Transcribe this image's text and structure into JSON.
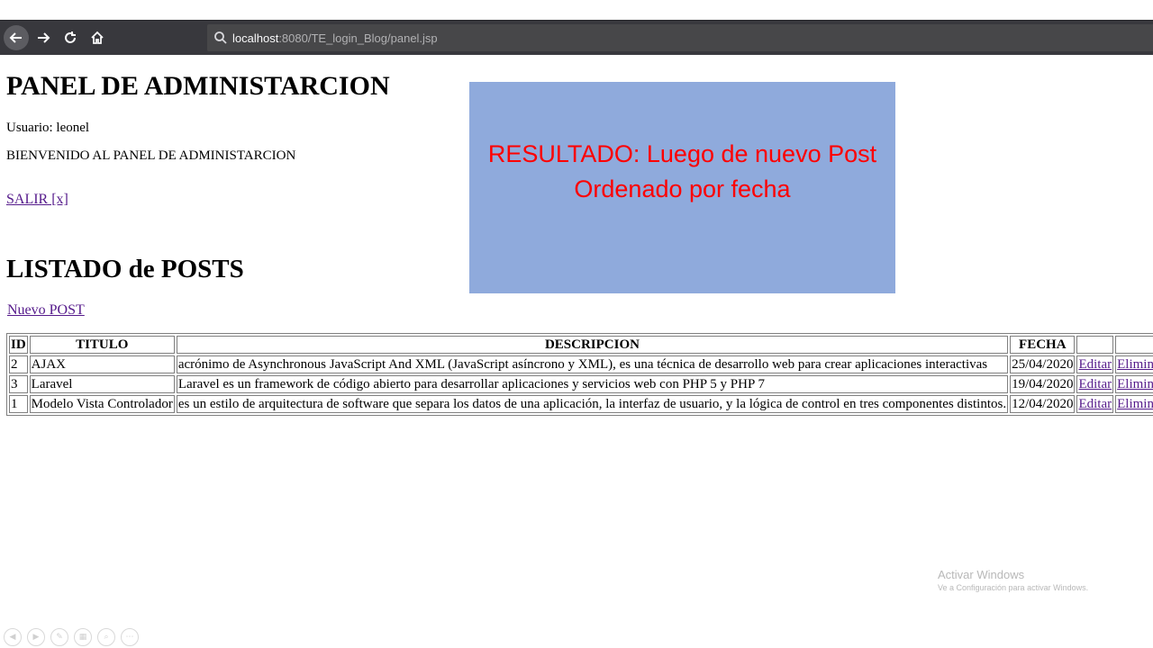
{
  "browser": {
    "url_host": "localhost",
    "url_path": ":8080/TE_login_Blog/panel.jsp"
  },
  "page": {
    "title": "PANEL DE ADMINISTARCION",
    "user_line": "Usuario: leonel",
    "welcome": "BIENVENIDO AL PANEL DE ADMINISTARCION",
    "logout_label": "SALIR [x]",
    "list_title": "LISTADO de POSTS",
    "new_post_label": "Nuevo POST"
  },
  "overlay": {
    "line1": "RESULTADO: Luego de nuevo Post",
    "line2": "Ordenado por fecha",
    "background": "#8faadc",
    "text_color": "#ff0000"
  },
  "table": {
    "headers": [
      "ID",
      "TITULO",
      "DESCRIPCION",
      "FECHA",
      "",
      ""
    ],
    "rows": [
      {
        "id": "2",
        "titulo": "AJAX",
        "descripcion": "acrónimo de Asynchronous JavaScript And XML (JavaScript asíncrono y XML), es una técnica de desarrollo web para crear aplicaciones interactivas",
        "fecha": "25/04/2020",
        "edit": "Editar",
        "delete": "Eliminar"
      },
      {
        "id": "3",
        "titulo": "Laravel",
        "descripcion": "Laravel es un framework de código abierto para desarrollar aplicaciones y servicios web con PHP 5 y PHP 7",
        "fecha": "19/04/2020",
        "edit": "Editar",
        "delete": "Eliminar"
      },
      {
        "id": "1",
        "titulo": "Modelo Vista Controlador",
        "descripcion": "es un estilo de arquitectura de software que separa los datos de una aplicación, la interfaz de usuario, y la lógica de control en tres componentes distintos.",
        "fecha": "12/04/2020",
        "edit": "Editar",
        "delete": "Eliminar"
      }
    ]
  },
  "watermark": {
    "line1": "Activar Windows",
    "line2": "Ve a Configuración para activar Windows."
  },
  "icons": [
    "back-arrow-icon",
    "forward-arrow-icon",
    "reload-icon",
    "home-icon",
    "search-icon"
  ],
  "colors": {
    "link": "#551a8b",
    "toolbar": "#38383d",
    "urlbar": "#474749"
  }
}
